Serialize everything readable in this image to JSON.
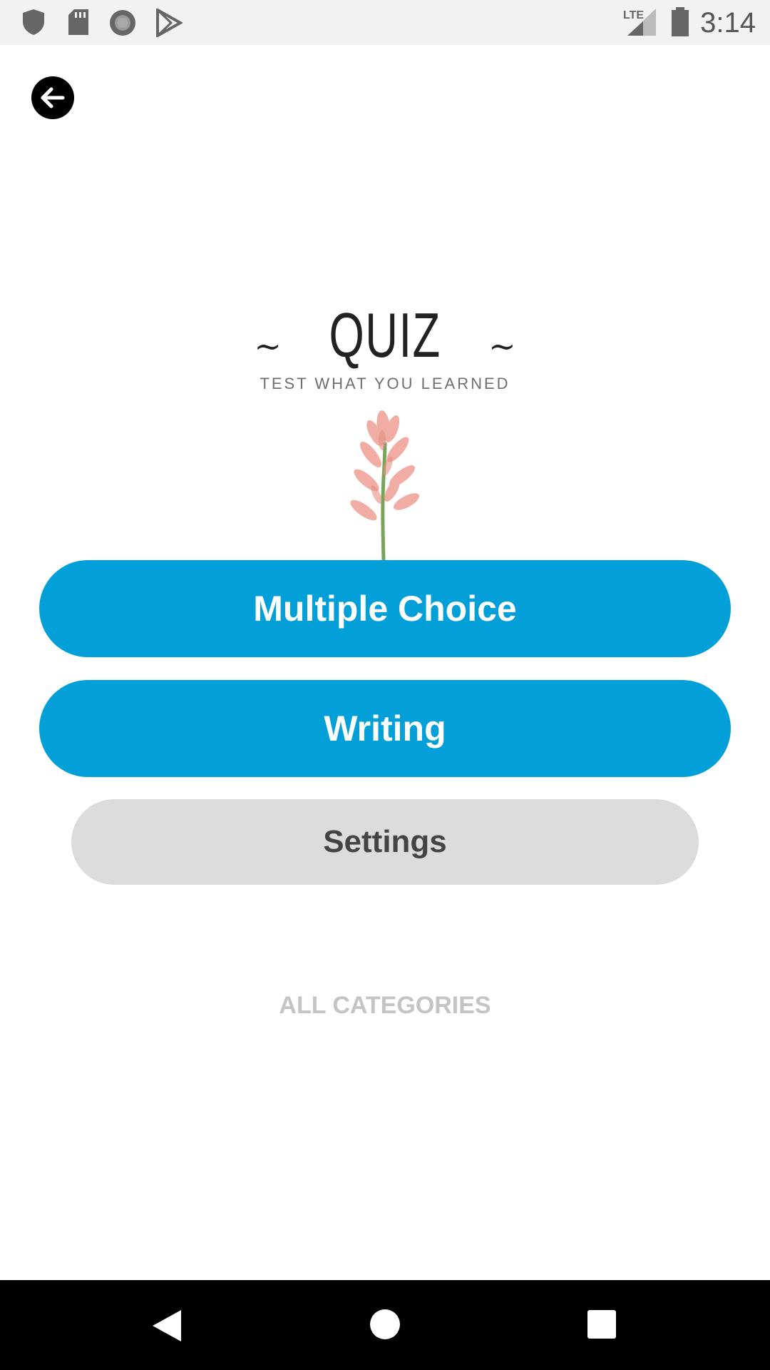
{
  "status_bar": {
    "time": "3:14",
    "network": "LTE",
    "icons": [
      "shield-icon",
      "sd-card-icon",
      "record-icon",
      "play-store-icon",
      "signal-icon",
      "battery-icon"
    ]
  },
  "header": {
    "back_icon": "arrow-left-icon"
  },
  "title": {
    "text": "QUIZ",
    "dash_left": "~",
    "dash_right": "~",
    "subtitle": "TEST WHAT YOU LEARNED"
  },
  "buttons": {
    "multiple_choice": "Multiple Choice",
    "writing": "Writing",
    "settings": "Settings"
  },
  "footer_link": "ALL CATEGORIES",
  "colors": {
    "primary": "#029fd8",
    "secondary": "#dcdcdc",
    "muted": "#c4c4c4"
  },
  "nav_bar": {
    "icons": [
      "back-triangle-icon",
      "home-circle-icon",
      "recents-square-icon"
    ]
  }
}
